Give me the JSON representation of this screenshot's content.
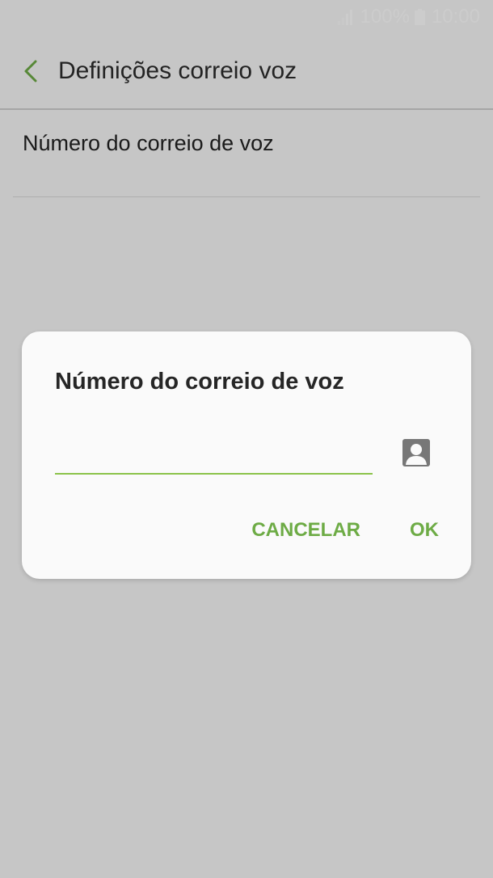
{
  "status_bar": {
    "battery_level": "100%",
    "time": "10:00"
  },
  "app_bar": {
    "title": "Definições correio voz"
  },
  "settings": [
    {
      "label": "Número do correio de voz"
    }
  ],
  "dialog": {
    "title": "Número do correio de voz",
    "input_value": "",
    "cancel_label": "CANCELAR",
    "ok_label": "OK"
  },
  "colors": {
    "accent": "#6dab45",
    "input_underline": "#8bc34a",
    "background": "#f8f8f8",
    "scrim": "rgba(0,0,0,0.2)"
  },
  "icons": {
    "back": "chevron-left-icon",
    "contacts": "contact-icon",
    "signal": "signal-icon",
    "battery": "battery-icon"
  }
}
